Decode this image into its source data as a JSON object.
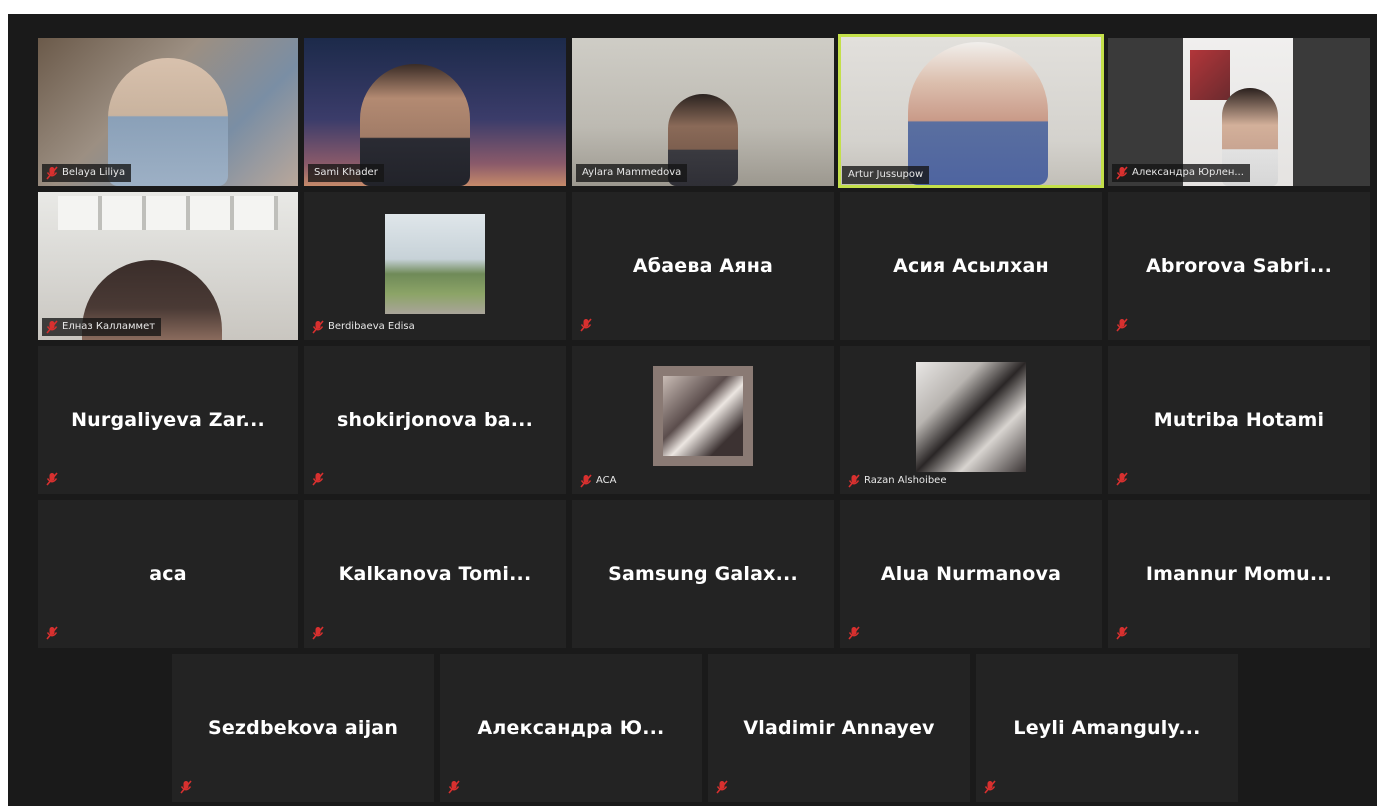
{
  "meeting": {
    "participants": [
      {
        "name": "Belaya Liliya",
        "muted": true,
        "mode": "video"
      },
      {
        "name": "Sami Khader",
        "muted": false,
        "mode": "video"
      },
      {
        "name": "Aylara Mammedova",
        "muted": false,
        "mode": "video"
      },
      {
        "name": "Artur Jussupow",
        "muted": false,
        "mode": "video",
        "active_speaker": true
      },
      {
        "name": "Александра Юрлен...",
        "muted": true,
        "mode": "video"
      },
      {
        "name": "Елназ Калламмет",
        "muted": true,
        "mode": "video"
      },
      {
        "name": "Berdibaeva Edisa",
        "muted": true,
        "mode": "picture"
      },
      {
        "name": "Абаева Аяна",
        "muted": true,
        "mode": "name"
      },
      {
        "name": "Асия Асылхан",
        "muted": false,
        "mode": "name"
      },
      {
        "name": "Abrorova Sabri...",
        "muted": true,
        "mode": "name"
      },
      {
        "name": "Nurgaliyeva Zar...",
        "muted": true,
        "mode": "name"
      },
      {
        "name": "shokirjonova ba...",
        "muted": true,
        "mode": "name"
      },
      {
        "name": "ACA",
        "muted": true,
        "mode": "picture"
      },
      {
        "name": "Razan Alshoibee",
        "muted": true,
        "mode": "picture"
      },
      {
        "name": "Mutriba Hotami",
        "muted": true,
        "mode": "name"
      },
      {
        "name": "aca",
        "muted": true,
        "mode": "name"
      },
      {
        "name": "Kalkanova Tomi...",
        "muted": true,
        "mode": "name"
      },
      {
        "name": "Samsung Galax...",
        "muted": false,
        "mode": "name"
      },
      {
        "name": "Alua Nurmanova",
        "muted": true,
        "mode": "name"
      },
      {
        "name": "Imannur Momu...",
        "muted": true,
        "mode": "name"
      },
      {
        "name": "Sezdbekova aijan",
        "muted": true,
        "mode": "name"
      },
      {
        "name": "Александра Ю...",
        "muted": true,
        "mode": "name"
      },
      {
        "name": "Vladimir Annayev",
        "muted": true,
        "mode": "name"
      },
      {
        "name": "Leyli Amanguly...",
        "muted": true,
        "mode": "name"
      }
    ]
  },
  "colors": {
    "mute_icon": "#d8302f",
    "active_speaker_border": "#c4e04a",
    "tile_bg": "#232323",
    "gallery_bg": "#1a1a1a"
  },
  "icons": {
    "muted": "muted-mic-icon"
  }
}
